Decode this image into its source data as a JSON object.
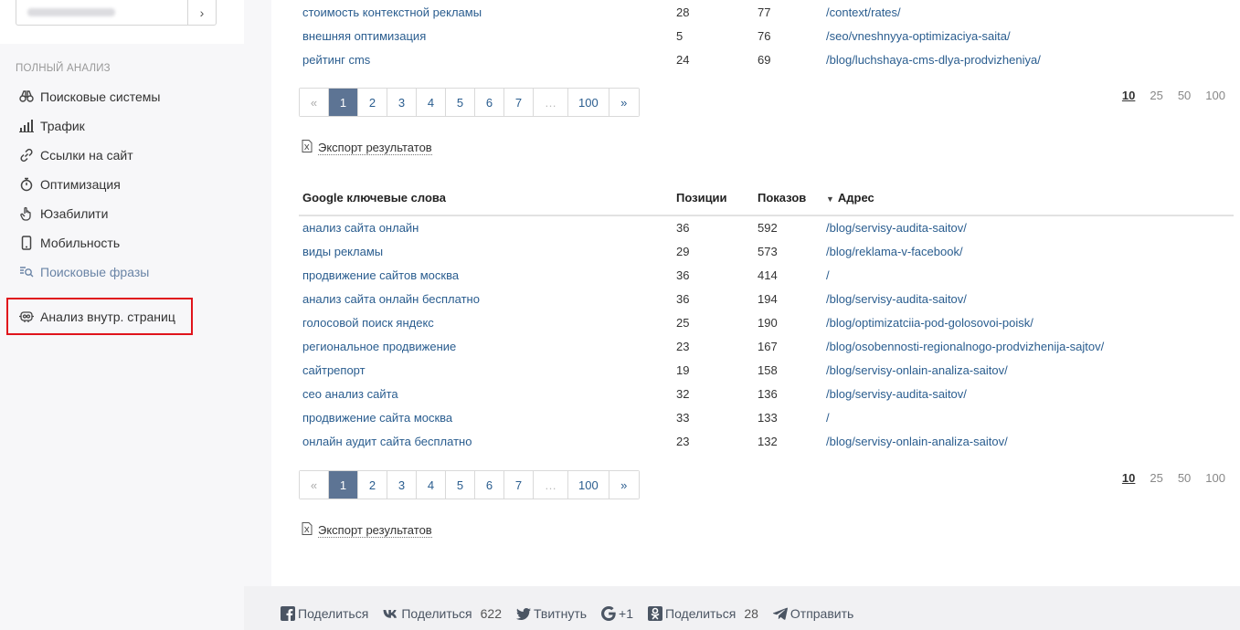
{
  "sidebar": {
    "search_go": "›",
    "section_title": "ПОЛНЫЙ АНАЛИЗ",
    "items": [
      {
        "label": "Поисковые системы"
      },
      {
        "label": "Трафик"
      },
      {
        "label": "Ссылки на сайт"
      },
      {
        "label": "Оптимизация"
      },
      {
        "label": "Юзабилити"
      },
      {
        "label": "Мобильность"
      },
      {
        "label": "Поисковые фразы"
      }
    ],
    "extra_item": {
      "label": "Анализ внутр. страниц"
    }
  },
  "table1": {
    "rows": [
      {
        "kw": "стоимость контекстной рекламы",
        "pos": "28",
        "shows": "77",
        "addr": "/context/rates/"
      },
      {
        "kw": "внешняя оптимизация",
        "pos": "5",
        "shows": "76",
        "addr": "/seo/vneshnyya-optimizaciya-saita/"
      },
      {
        "kw": "рейтинг cms",
        "pos": "24",
        "shows": "69",
        "addr": "/blog/luchshaya-cms-dlya-prodvizheniya/"
      }
    ]
  },
  "pager": {
    "prev": "«",
    "pages": [
      "1",
      "2",
      "3",
      "4",
      "5",
      "6",
      "7"
    ],
    "dots": "…",
    "last": "100",
    "next": "»"
  },
  "perpage": [
    "10",
    "25",
    "50",
    "100"
  ],
  "export_label": "Экспорт результатов",
  "table2": {
    "headers": {
      "kw": "Google ключевые слова",
      "pos": "Позиции",
      "shows": "Показов",
      "addr": "Адрес"
    },
    "rows": [
      {
        "kw": "анализ сайта онлайн",
        "pos": "36",
        "shows": "592",
        "addr": "/blog/servisy-audita-saitov/"
      },
      {
        "kw": "виды рекламы",
        "pos": "29",
        "shows": "573",
        "addr": "/blog/reklama-v-facebook/"
      },
      {
        "kw": "продвижение сайтов москва",
        "pos": "36",
        "shows": "414",
        "addr": "/"
      },
      {
        "kw": "анализ сайта онлайн бесплатно",
        "pos": "36",
        "shows": "194",
        "addr": "/blog/servisy-audita-saitov/"
      },
      {
        "kw": "голосовой поиск яндекс",
        "pos": "25",
        "shows": "190",
        "addr": "/blog/optimizatciia-pod-golosovoi-poisk/"
      },
      {
        "kw": "региональное продвижение",
        "pos": "23",
        "shows": "167",
        "addr": "/blog/osobennosti-regionalnogo-prodvizhenija-sajtov/"
      },
      {
        "kw": "сайтрепорт",
        "pos": "19",
        "shows": "158",
        "addr": "/blog/servisy-onlain-analiza-saitov/"
      },
      {
        "kw": "сео анализ сайта",
        "pos": "32",
        "shows": "136",
        "addr": "/blog/servisy-audita-saitov/"
      },
      {
        "kw": "продвижение сайта москва",
        "pos": "33",
        "shows": "133",
        "addr": "/"
      },
      {
        "kw": "онлайн аудит сайта бесплатно",
        "pos": "23",
        "shows": "132",
        "addr": "/blog/servisy-onlain-analiza-saitov/"
      }
    ]
  },
  "footer": {
    "facebook": {
      "label": "Поделиться"
    },
    "vk": {
      "label": "Поделиться",
      "count": "622"
    },
    "twitter": {
      "label": "Твитнуть"
    },
    "gplus": {
      "label": "+1"
    },
    "ok": {
      "label": "Поделиться",
      "count": "28"
    },
    "telegram": {
      "label": "Отправить"
    }
  }
}
